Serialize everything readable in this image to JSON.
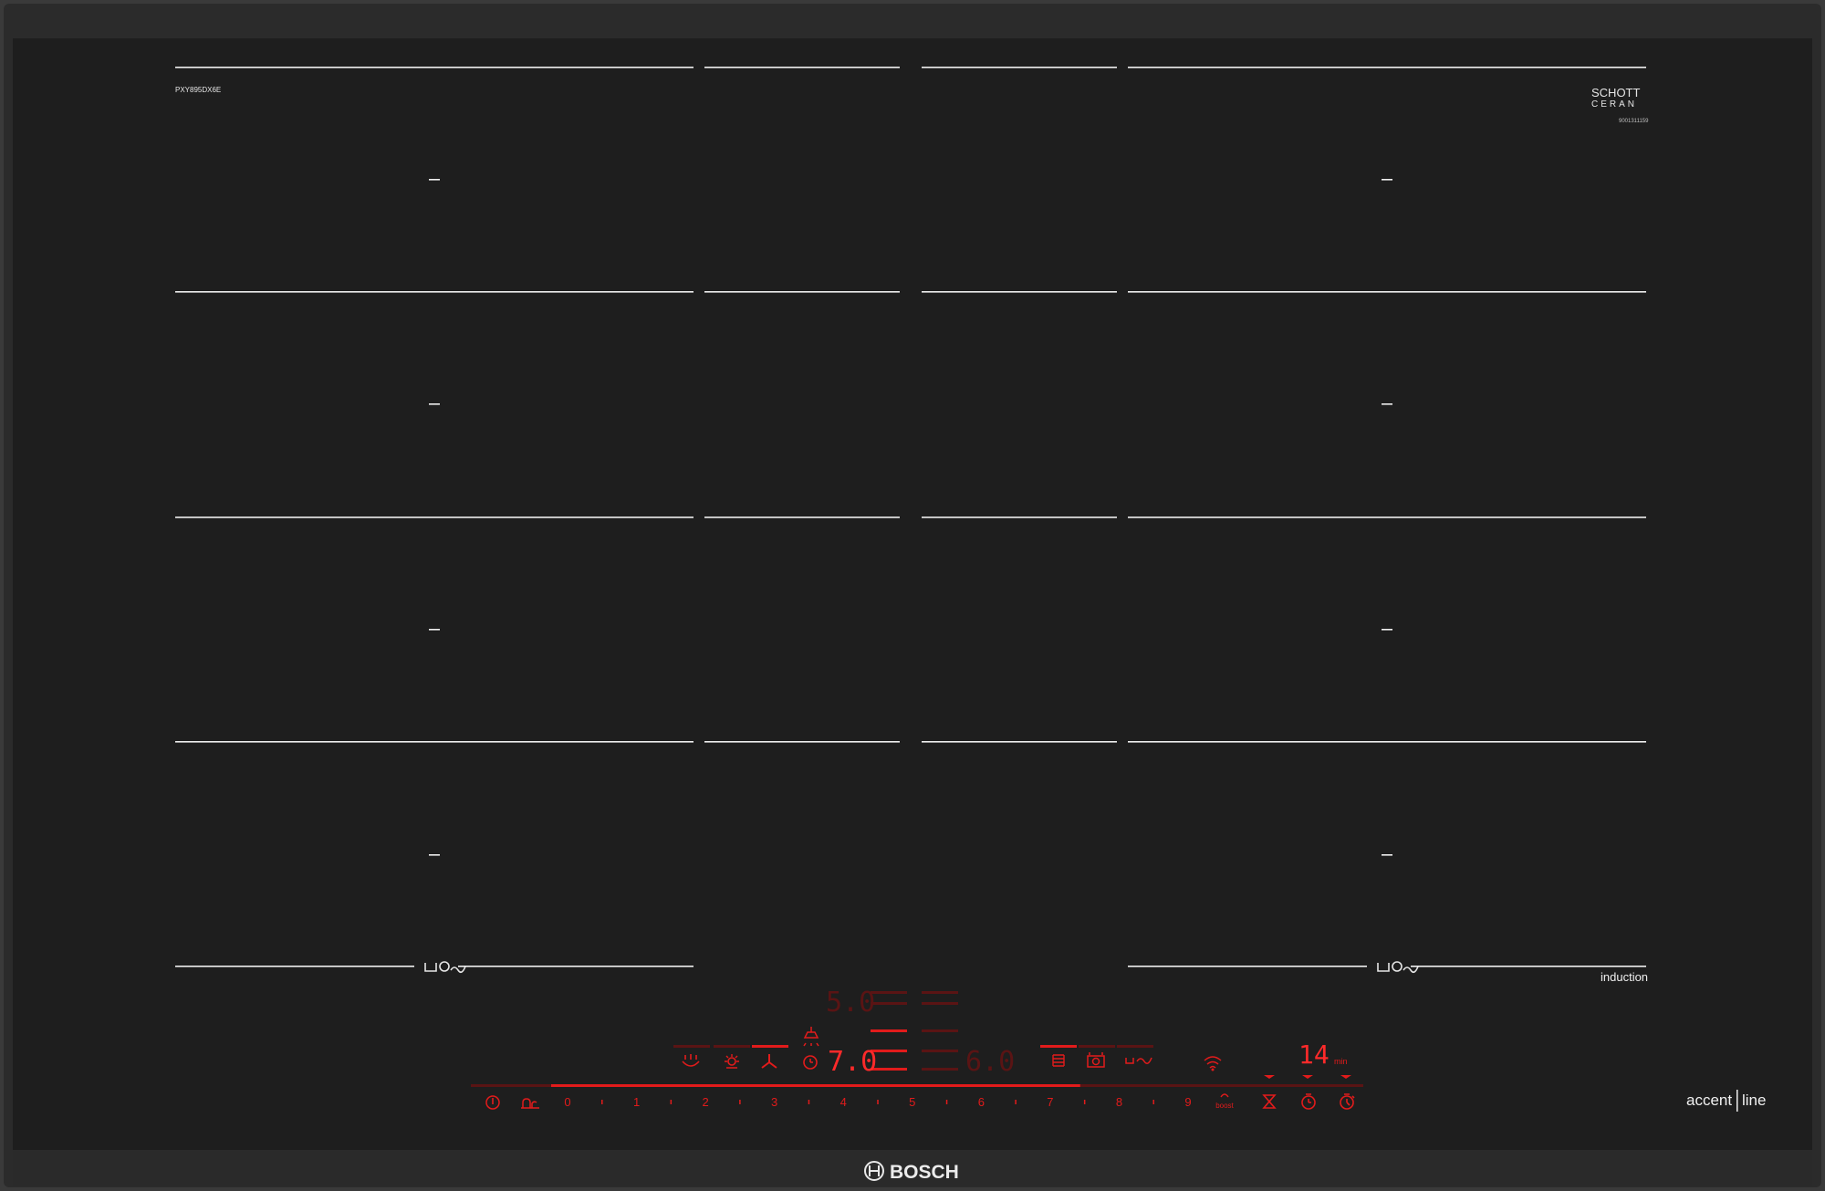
{
  "product": {
    "model_code": "PXY895DX6E",
    "glass_brand_line1": "SCHOTT",
    "glass_brand_line2": "CERAN",
    "glass_serial": "9001311159",
    "cooking_type": "induction",
    "series_word1": "accent",
    "series_word2": "line",
    "brand": "BOSCH"
  },
  "zone_icon": "cookware-move-icon",
  "displays": {
    "upper_level": "5.0",
    "active_level": "7.0",
    "right_level": "6.0",
    "timer_minutes": "14",
    "timer_unit": "min"
  },
  "power_scale": [
    "0",
    "1",
    "2",
    "3",
    "4",
    "5",
    "6",
    "7",
    "8",
    "9"
  ],
  "boost_label": "boost",
  "active_level_fraction": 0.7,
  "controls": {
    "power": "power-icon",
    "child_lock": "child-lock-icon",
    "function_icons": [
      "roasting-sensor-icon",
      "keep-warm-icon",
      "hood-fan-icon",
      "hood-light-icon",
      "timer-icon"
    ],
    "right_icons": [
      "flex-zone-icon",
      "pan-detect-icon",
      "move-mode-icon",
      "home-connect-wifi-icon"
    ],
    "timer_icons": [
      "hourglass-icon",
      "stopwatch-icon",
      "countdown-icon"
    ]
  },
  "colors": {
    "frame": "#2b2b2b",
    "glass": "#1e1e1e",
    "markings": "#f2f2f2",
    "led_red": "#e21b1b",
    "led_dim": "#5a1414"
  }
}
